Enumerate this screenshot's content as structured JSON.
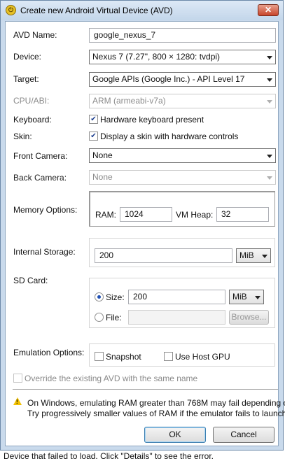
{
  "window": {
    "title": "Create new Android Virtual Device (AVD)",
    "close_label": "✕"
  },
  "form": {
    "avd_name_label": "AVD Name:",
    "avd_name_value": "google_nexus_7",
    "device_label": "Device:",
    "device_value": "Nexus 7 (7.27\", 800 × 1280: tvdpi)",
    "target_label": "Target:",
    "target_value": "Google APIs (Google Inc.) - API Level 17",
    "cpu_label": "CPU/ABI:",
    "cpu_value": "ARM (armeabi-v7a)",
    "keyboard_label": "Keyboard:",
    "keyboard_check_label": "Hardware keyboard present",
    "keyboard_checked": true,
    "skin_label": "Skin:",
    "skin_check_label": "Display a skin with hardware controls",
    "skin_checked": true,
    "front_camera_label": "Front Camera:",
    "front_camera_value": "None",
    "back_camera_label": "Back Camera:",
    "back_camera_value": "None",
    "memory_label": "Memory Options:",
    "ram_label": "RAM:",
    "ram_value": "1024",
    "vm_heap_label": "VM Heap:",
    "vm_heap_value": "32",
    "internal_storage_label": "Internal Storage:",
    "internal_storage_value": "200",
    "internal_storage_unit": "MiB",
    "sd_card_label": "SD Card:",
    "sd_size_label": "Size:",
    "sd_size_value": "200",
    "sd_size_unit": "MiB",
    "sd_file_label": "File:",
    "sd_file_value": "",
    "browse_label": "Browse...",
    "emulation_label": "Emulation Options:",
    "snapshot_label": "Snapshot",
    "host_gpu_label": "Use Host GPU",
    "override_label": "Override the existing AVD with the same name"
  },
  "warning": {
    "line1": "On Windows, emulating RAM greater than 768M may fail depending o",
    "line2": "Try progressively smaller values of RAM if the emulator fails to launch"
  },
  "buttons": {
    "ok": "OK",
    "cancel": "Cancel"
  },
  "status": {
    "text": "Device that failed to load. Click \"Details\" to see the error."
  },
  "colors": {
    "title_gradient": "#c3d6ea",
    "close_button": "#c7442a",
    "radio_selected": "#1f4fb3"
  }
}
